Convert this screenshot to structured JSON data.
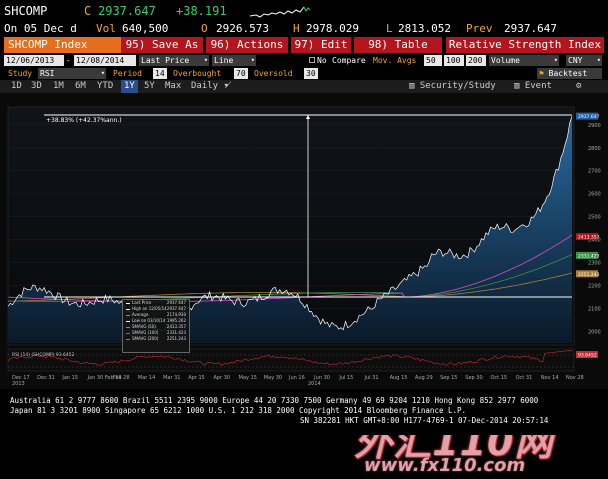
{
  "header": {
    "ticker": "SHCOMP",
    "flag": "C",
    "last": "2937.647",
    "change": "+38.191",
    "line2_prefix": "On 05 Dec d",
    "vol_label": "Vol",
    "vol": "640,500",
    "open_label": "O",
    "open": "2926.573",
    "high_label": "H",
    "high": "2978.029",
    "low_label": "L",
    "low": "2813.052",
    "prev_label": "Prev",
    "prev": "2937.647"
  },
  "menubar": {
    "index_title": "SHCOMP Index",
    "save_as": "95) Save As",
    "actions": "96) Actions",
    "edit": "97) Edit",
    "table": "98) Table",
    "study_title": "Relative Strength Index"
  },
  "inputs": {
    "start_date": "12/06/2013",
    "end_date": "12/08/2014",
    "price_type": "Last Price",
    "chart_style": "Line",
    "no_compare_label": "No",
    "compare_label": "Compare",
    "mov_avgs_label": "Mov. Avgs",
    "mov_avg_1": "50",
    "mov_avg_2": "100",
    "mov_avg_3": "200",
    "volume_label": "Volume",
    "currency": "CNY",
    "study_label": "Study",
    "study_value": "RSI",
    "period_label": "Period",
    "period_value": "14",
    "overbought_label": "Overbought",
    "overbought_value": "70",
    "oversold_label": "Oversold",
    "oversold_value": "30",
    "backtest_label": "Backtest"
  },
  "tabs": {
    "ranges": [
      "1D",
      "3D",
      "1M",
      "6M",
      "YTD",
      "1Y",
      "5Y",
      "Max"
    ],
    "active_range": "1Y",
    "frequency": "Daily",
    "security_study": "Security/Study",
    "event": "Event"
  },
  "chart": {
    "annotation": "+38.83% (+42.37%ann.)",
    "rsi_label": "RSI (14) (SHCOMP) 93.6452",
    "y_ticks": [
      "2900",
      "2800",
      "2700",
      "2600",
      "2500",
      "2400",
      "2300",
      "2200",
      "2100",
      "2000"
    ],
    "right_badges": [
      "2937.647",
      "2413.357",
      "2331.423",
      "2251.243"
    ],
    "rsi_badge": "93.6452",
    "x_ticks": [
      "Dec 17",
      "Dec 31",
      "Jan 15",
      "Jan 30 Feb 14",
      "Feb 28",
      "Mar 14",
      "Mar 31",
      "Apr 15",
      "Apr 30",
      "May 15",
      "May 30",
      "Jun 16",
      "Jun 30",
      "Jul 15",
      "Jul 31",
      "Aug 15",
      "Aug 29",
      "Sep 15",
      "Sep 30",
      "Oct 15",
      "Oct 31",
      "Nov 14",
      "Nov 28"
    ],
    "x_years": [
      "2013",
      "2014"
    ],
    "legend": [
      {
        "label": "Last Price",
        "value": "2937.647"
      },
      {
        "label": "High on 12/05/14",
        "value": "2937.647"
      },
      {
        "label": "Average",
        "value": "2174.930"
      },
      {
        "label": "Low on 03/10/14",
        "value": "1995.262"
      },
      {
        "label": "SMAVG (50)",
        "value": "2413.357"
      },
      {
        "label": "SMAVG (100)",
        "value": "2331.423"
      },
      {
        "label": "SMAVG (200)",
        "value": "2251.243"
      }
    ],
    "colors": {
      "price_line": "#ffffff",
      "area_top": "#2a6fa8",
      "area_bottom": "#0a1a2a",
      "sma50": "#d64fc9",
      "sma100": "#3e8f4a",
      "sma200": "#a8803c",
      "rsi": "#c72b3a"
    }
  },
  "footer": {
    "line1": "Australia 61 2 9777 8600 Brazil 5511 2395 9000 Europe 44 20 7330 7500 Germany 49 69 9204 1210 Hong Kong 852 2977 6000",
    "line2": "Japan 81 3 3201 8900          Singapore 65 6212 1000          U.S. 1 212 318 2000          Copyright 2014 Bloomberg Finance L.P.",
    "line3": "SN 382281 HKT  GMT+8:00 H177-4769-1 07-Dec-2014 20:57:14"
  },
  "watermark": {
    "text": "外汇110网",
    "url": "www.fx110.com"
  }
}
